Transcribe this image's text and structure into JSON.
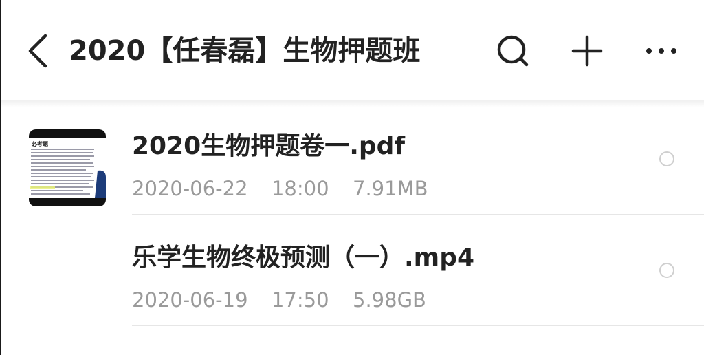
{
  "header": {
    "title": "2020【任春磊】生物押题班",
    "back_icon": "chevron-left-icon",
    "search_icon": "search-icon",
    "add_icon": "plus-icon",
    "more_icon": "more-horizontal-icon"
  },
  "files": [
    {
      "name": "2020生物押题卷一.pdf",
      "date": "2020-06-22",
      "time": "18:00",
      "size": "7.91MB",
      "icon": "pdf-file-icon",
      "selected": false
    },
    {
      "name": "乐学生物终极预测（一）.mp4",
      "date": "2020-06-19",
      "time": "17:50",
      "size": "5.98GB",
      "icon": "video-thumbnail",
      "thumbnail_heading": "必考题",
      "selected": false
    }
  ],
  "colors": {
    "title_text": "#222222",
    "meta_text": "#9a9a9a",
    "pdf_red": "#f05454",
    "divider": "#e6e6e6"
  }
}
